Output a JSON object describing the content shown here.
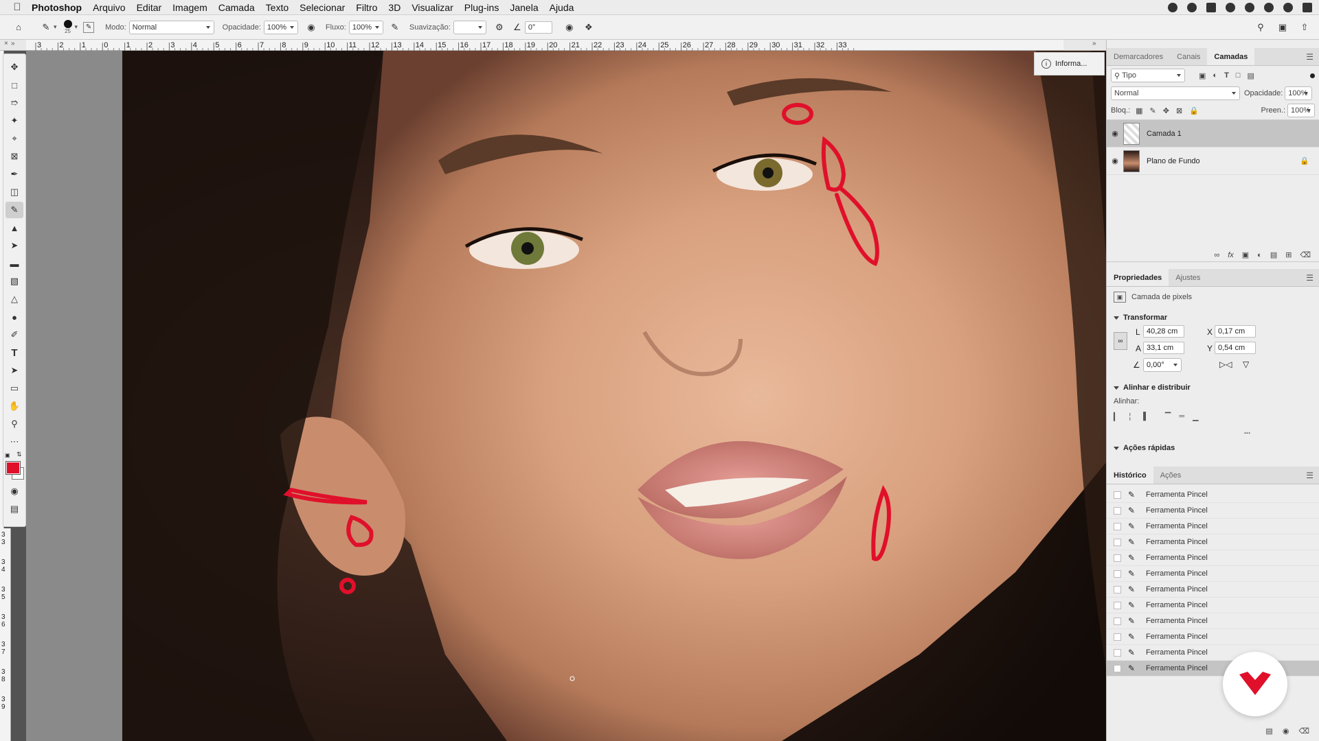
{
  "menubar": {
    "app": "Photoshop",
    "items": [
      "Arquivo",
      "Editar",
      "Imagem",
      "Camada",
      "Texto",
      "Selecionar",
      "Filtro",
      "3D",
      "Visualizar",
      "Plug-ins",
      "Janela",
      "Ajuda"
    ]
  },
  "options": {
    "brush_size": "25",
    "mode_label": "Modo:",
    "mode_value": "Normal",
    "opacity_label": "Opacidade:",
    "opacity_value": "100%",
    "flow_label": "Fluxo:",
    "flow_value": "100%",
    "smoothing_label": "Suavização:",
    "smoothing_value": "",
    "angle_value": "0°"
  },
  "ruler": {
    "labels": [
      "3",
      "2",
      "1",
      "0",
      "1",
      "2",
      "3",
      "4",
      "5",
      "6",
      "7",
      "8",
      "9",
      "10",
      "11",
      "12",
      "13",
      "14",
      "15",
      "16",
      "17",
      "18",
      "19",
      "20",
      "21",
      "22",
      "23",
      "24",
      "25",
      "26",
      "27",
      "28",
      "29",
      "30",
      "31",
      "32",
      "33"
    ],
    "vertical_labels": [
      "3\n3",
      "3\n4",
      "3\n5",
      "3\n6",
      "3\n7",
      "3\n8",
      "3\n9"
    ]
  },
  "info_panel": {
    "label": "Informa..."
  },
  "layers_panel": {
    "tabs": [
      "Demarcadores",
      "Canais",
      "Camadas"
    ],
    "active_tab": "Camadas",
    "filter_value": "Tipo",
    "blend_mode": "Normal",
    "opacity_label": "Opacidade:",
    "opacity_value": "100%",
    "lock_label": "Bloq.:",
    "fill_label": "Preen.:",
    "fill_value": "100%",
    "layers": [
      {
        "name": "Camada 1",
        "selected": true
      },
      {
        "name": "Plano de Fundo",
        "selected": false
      }
    ]
  },
  "properties_panel": {
    "tabs": [
      "Propriedades",
      "Ajustes"
    ],
    "active_tab": "Propriedades",
    "kind": "Camada de pixels",
    "transform_title": "Transformar",
    "w_label": "L",
    "w_value": "40,28 cm",
    "h_label": "A",
    "h_value": "33,1 cm",
    "x_label": "X",
    "x_value": "0,17 cm",
    "y_label": "Y",
    "y_value": "0,54 cm",
    "angle_value": "0,00°",
    "align_title": "Alinhar e distribuir",
    "align_label": "Alinhar:",
    "more": "...",
    "quick_title": "Ações rápidas"
  },
  "history_panel": {
    "tabs": [
      "Histórico",
      "Ações"
    ],
    "active_tab": "Histórico",
    "items": [
      "Ferramenta Pincel",
      "Ferramenta Pincel",
      "Ferramenta Pincel",
      "Ferramenta Pincel",
      "Ferramenta Pincel",
      "Ferramenta Pincel",
      "Ferramenta Pincel",
      "Ferramenta Pincel",
      "Ferramenta Pincel",
      "Ferramenta Pincel",
      "Ferramenta Pincel",
      "Ferramenta Pincel"
    ]
  },
  "colors": {
    "foreground": "#e0102b",
    "background": "#ffffff",
    "accent": "#e0102b"
  }
}
